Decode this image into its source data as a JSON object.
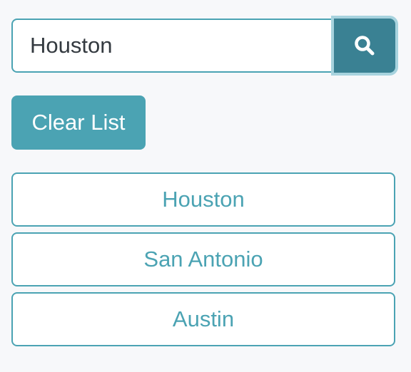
{
  "search": {
    "value": "Houston",
    "button_icon": "search-icon"
  },
  "clear_button": {
    "label": "Clear List"
  },
  "cities": [
    {
      "label": "Houston"
    },
    {
      "label": "San Antonio"
    },
    {
      "label": "Austin"
    }
  ],
  "colors": {
    "accent": "#4ba3b3",
    "accent_dark": "#3a8193",
    "background": "#f7f8fa"
  }
}
